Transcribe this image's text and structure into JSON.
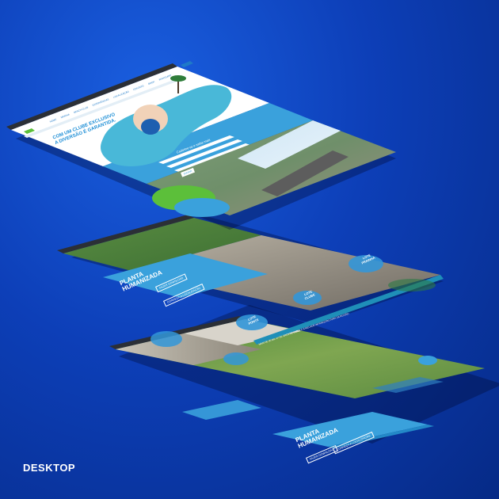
{
  "caption": "DESKTOP",
  "screen1": {
    "nav_items": [
      "HOME",
      "MARINA",
      "BEACH CLUB",
      "EXPERIÊNCIAS",
      "LOCALIZAÇÃO",
      "CONTATO",
      "BOOK",
      "WHATSAPP"
    ],
    "headline_line1": "COM UM CLUBE EXCLUSIVO",
    "headline_line2": "A DIVERSÃO É GARANTIDA.",
    "form_title": "Cadastre-se e saiba mais",
    "form_button": "ENVIAR"
  },
  "screen2": {
    "title_line1": "PLANTA",
    "title_line2": "HUMANIZADA",
    "button1": "FAZER DOWNLOAD",
    "button2": "CONHEÇA A LOCALIZAÇÃO",
    "circle1": "LOTE PRAINHA",
    "circle2": "LOTE CLUBE",
    "circle3": "LOTE PONTE",
    "strip_text": "MAIS DE 30 MIL m² DE ÁREA DE LAZER E A MELHOR INFRAESTRUTURA DA REGIÃO"
  },
  "screen3": {
    "title_line1": "PLANTA",
    "title_line2": "HUMANIZADA",
    "button1": "FAZER DOWNLOAD",
    "button2": "CONHEÇA A LOCALIZAÇÃO"
  },
  "colors": {
    "background": "#0d3fb8",
    "brand_blue": "#3aa1dc",
    "brand_green": "#5cbf3a",
    "dark_bar": "#2b2f36"
  }
}
